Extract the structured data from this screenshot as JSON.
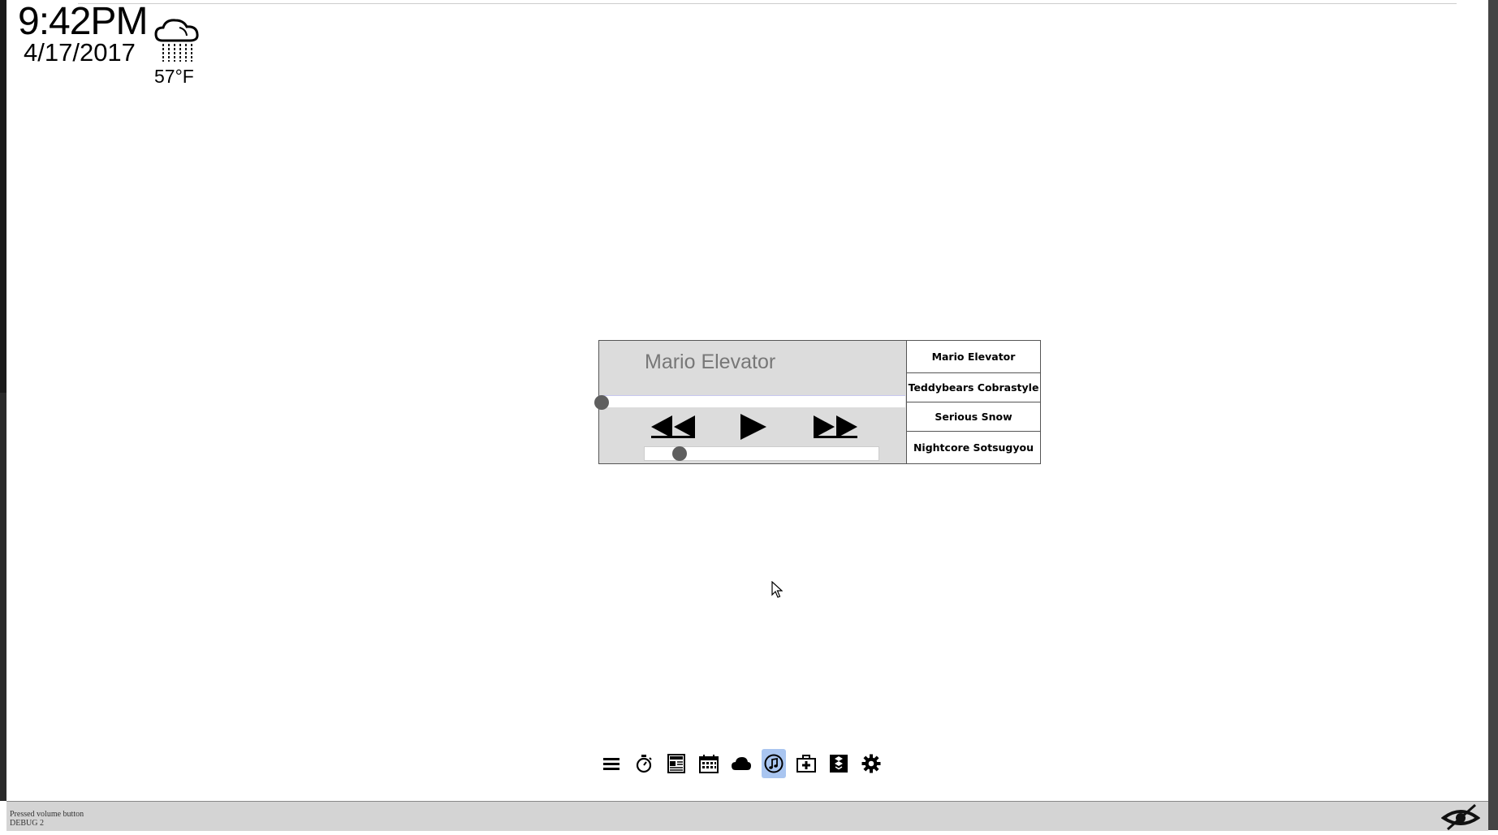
{
  "header": {
    "time": "9:42PM",
    "date": "4/17/2017",
    "weather_icon": "rain-cloud-icon",
    "temperature": "57°F"
  },
  "player": {
    "current_song": "Mario Elevator",
    "progress": 0.0,
    "volume": 0.15,
    "controls": [
      "rewind-icon",
      "play-icon",
      "fast-forward-icon"
    ]
  },
  "playlist": {
    "items": [
      {
        "label": "Mario Elevator"
      },
      {
        "label": "Teddybears Cobrastyle"
      },
      {
        "label": "Serious Snow"
      },
      {
        "label": "Nightcore Sotsugyou"
      }
    ]
  },
  "dock": {
    "icons": [
      "menu-icon",
      "stopwatch-icon",
      "news-icon",
      "calendar-icon",
      "cloud-icon",
      "music-icon",
      "medical-kit-icon",
      "dropbox-icon",
      "gear-icon"
    ],
    "active": "music-icon",
    "active_color": "#a9c5f0"
  },
  "status_bar": {
    "line1": "Pressed volume button",
    "line2": "DEBUG 2",
    "hide_icon": "eye-slash-icon"
  }
}
